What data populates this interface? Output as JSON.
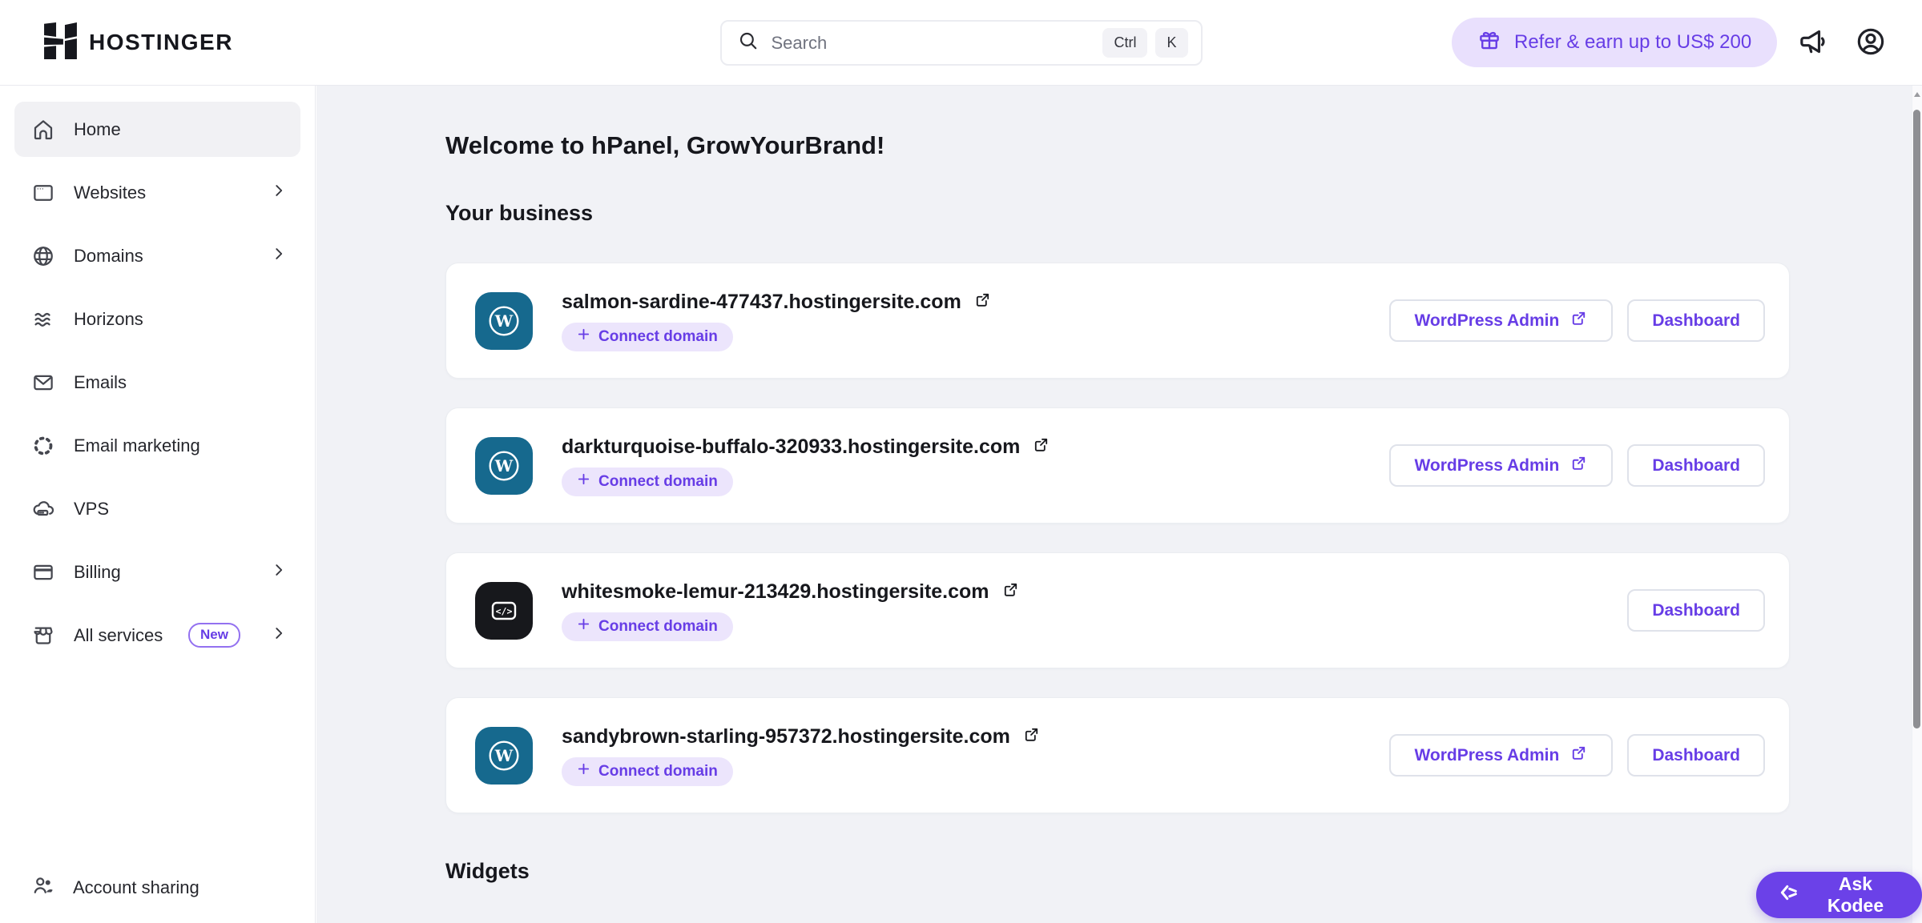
{
  "header": {
    "brand": "HOSTINGER",
    "search": {
      "placeholder": "Search",
      "key1": "Ctrl",
      "key2": "K"
    },
    "refer_label": "Refer & earn up to US$ 200"
  },
  "sidebar": {
    "items": [
      {
        "label": "Home"
      },
      {
        "label": "Websites"
      },
      {
        "label": "Domains"
      },
      {
        "label": "Horizons"
      },
      {
        "label": "Emails"
      },
      {
        "label": "Email marketing"
      },
      {
        "label": "VPS"
      },
      {
        "label": "Billing"
      },
      {
        "label": "All services",
        "badge": "New"
      }
    ],
    "account_sharing_label": "Account sharing"
  },
  "main": {
    "welcome_title": "Welcome to hPanel, GrowYourBrand!",
    "business_title": "Your business",
    "widgets_title": "Widgets",
    "connect_domain_label": "Connect domain",
    "actions": {
      "wordpress_admin": "WordPress Admin",
      "dashboard": "Dashboard"
    },
    "sites": [
      {
        "domain": "salmon-sardine-477437.hostingersite.com"
      },
      {
        "domain": "darkturquoise-buffalo-320933.hostingersite.com"
      },
      {
        "domain": "whitesmoke-lemur-213429.hostingersite.com"
      },
      {
        "domain": "sandybrown-starling-957372.hostingersite.com"
      }
    ]
  },
  "kodee_label": "Ask Kodee",
  "colors": {
    "brand_purple": "#673de6",
    "purple_tint": "#e9e0fd",
    "wordpress_teal": "#16698e",
    "code_tile_dark": "#17181c",
    "page_background": "#f1f2f6",
    "text_dark": "#16171d"
  }
}
